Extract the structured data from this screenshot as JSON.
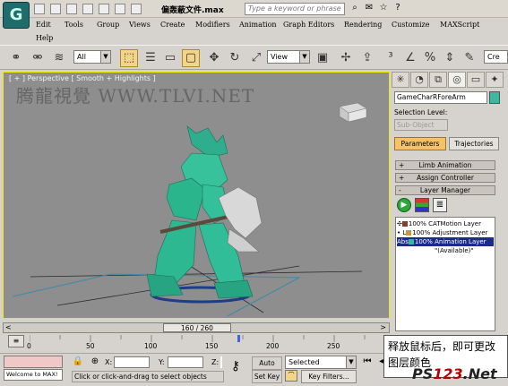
{
  "title_bar": {
    "logo": "G",
    "file_name": "偏轰蔽文件.max",
    "search_placeholder": "Type a keyword or phrase"
  },
  "menu": [
    "Edit",
    "Tools",
    "Group",
    "Views",
    "Create",
    "Modifiers",
    "Animation",
    "Graph Editors",
    "Rendering",
    "Customize",
    "MAXScript",
    "Help"
  ],
  "toolbar": {
    "selection_filter": "All",
    "reference_coord": "View",
    "named_selection": "Cre"
  },
  "viewport": {
    "label": "[ + ] Perspective [ Smooth + Highlights ]",
    "watermark": "腾龍視覺 WWW.TLVI.NET",
    "active_border_color": "#f2e800",
    "background_color": "#8e8e8e"
  },
  "panel": {
    "object_name": "GameCharRForeArm",
    "object_color": "#3ab8a4",
    "selection_level_label": "Selection Level:",
    "sub_object": "Sub-Object",
    "tab_parameters": "Parameters",
    "tab_trajectories": "Trajectories",
    "rollouts": [
      {
        "sign": "+",
        "label": "Limb Animation"
      },
      {
        "sign": "+",
        "label": "Assign Controller"
      },
      {
        "sign": "-",
        "label": "Layer Manager"
      }
    ],
    "layers": [
      {
        "prefix": "✣",
        "swatch": "#8b3a2a",
        "text": "100% CATMotion Layer",
        "selected": false
      },
      {
        "prefix": "• L",
        "swatch": "#c49a3a",
        "text": "100% Adjustment Layer",
        "selected": false
      },
      {
        "prefix": "Abs",
        "swatch": "#3ab8a4",
        "text": "100% Animation Layer",
        "selected": true
      },
      {
        "prefix": "",
        "swatch": "",
        "text": "\"(Available)\"",
        "selected": false
      }
    ]
  },
  "timeline": {
    "slider_text": "160 / 260",
    "current_frame": 160,
    "total_frames": 260,
    "ticks": [
      "0",
      "50",
      "100",
      "150",
      "200",
      "250"
    ]
  },
  "status": {
    "maxscript_text": "Welcome to MAX!",
    "x_label": "X:",
    "y_label": "Y:",
    "z_label": "Z:",
    "prompt": "Click or click-and-drag to select objects",
    "auto_key": "Auto Key",
    "set_key": "Set Key",
    "key_mode": "Selected",
    "key_filters": "Key Filters..."
  },
  "overlay_caption": "释放鼠标后，即可更改图层颜色",
  "brand": {
    "pre": "PS",
    "mid": "123",
    "post": ".Net"
  }
}
